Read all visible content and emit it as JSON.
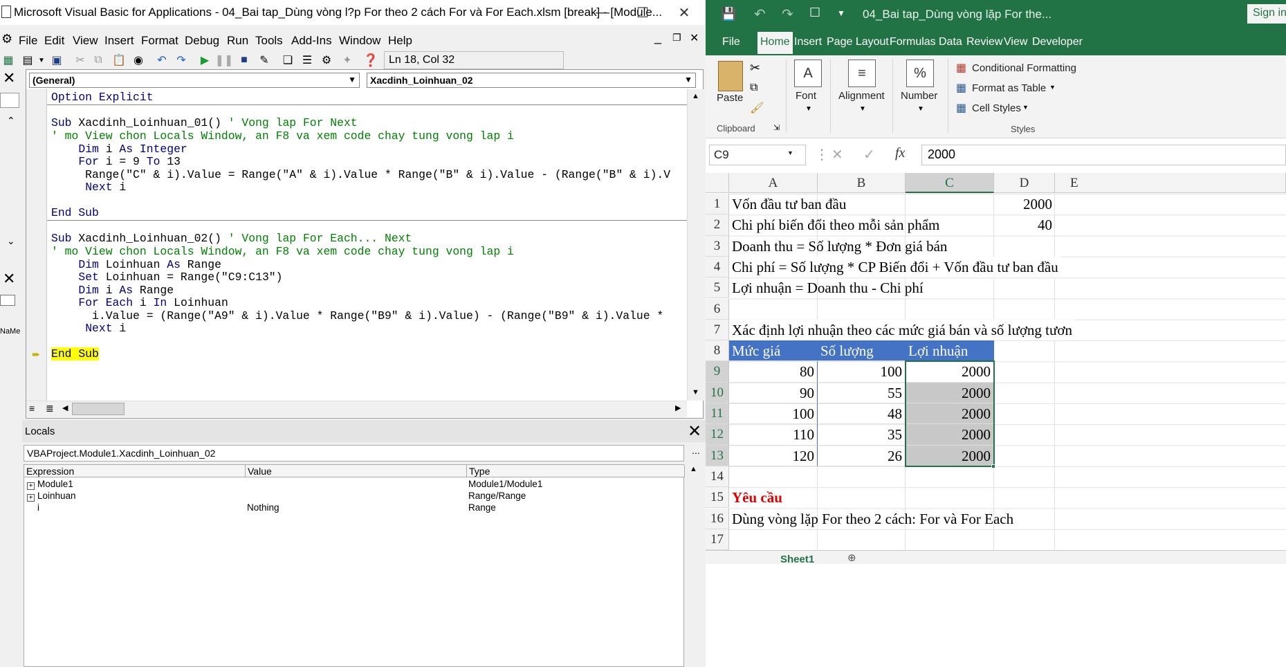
{
  "vba": {
    "title": "Microsoft Visual Basic for Applications - 04_Bai tap_Dùng vòng l?p For theo 2 cách For và For Each.xlsm [break] - [Module...",
    "menu": [
      "File",
      "Edit",
      "View",
      "Insert",
      "Format",
      "Debug",
      "Run",
      "Tools",
      "Add-Ins",
      "Window",
      "Help"
    ],
    "status": "Ln 18, Col 32",
    "combo_object": "(General)",
    "combo_proc": "Xacdinh_Loinhuan_02",
    "side_label": "NaMe",
    "code": {
      "l1": "Option Explicit",
      "l2": "Sub Xacdinh_Loinhuan_01() ' Vong lap For Next",
      "l3": "' mo View chon Locals Window, an F8 va xem code chay tung vong lap i",
      "l4": "    Dim i As Integer",
      "l5": "    For i = 9 To 13",
      "l6": "     Range(\"C\" & i).Value = Range(\"A\" & i).Value * Range(\"B\" & i).Value - (Range(\"B\" & i).V",
      "l7": "     Next i",
      "l8": "End Sub",
      "l9": "Sub Xacdinh_Loinhuan_02() ' Vong lap For Each... Next",
      "l10": "' mo View chon Locals Window, an F8 va xem code chay tung vong lap i",
      "l11": "    Dim Loinhuan As Range",
      "l12": "    Set Loinhuan = Range(\"C9:C13\")",
      "l13": "    Dim i As Range",
      "l14": "    For Each i In Loinhuan",
      "l15": "      i.Value = (Range(\"A9\" & i).Value * Range(\"B9\" & i).Value) - (Range(\"B9\" & i).Value *",
      "l16": "     Next i",
      "l17": "End Sub"
    },
    "locals": {
      "title": "Locals",
      "context": "VBAProject.Module1.Xacdinh_Loinhuan_02",
      "context_btn": "...",
      "headers": [
        "Expression",
        "Value",
        "Type"
      ],
      "rows": [
        {
          "expr": "Module1",
          "value": "",
          "type": "Module1/Module1",
          "expand": "+"
        },
        {
          "expr": "Loinhuan",
          "value": "",
          "type": "Range/Range",
          "expand": "+"
        },
        {
          "expr": "i",
          "value": "Nothing",
          "type": "Range",
          "expand": ""
        }
      ]
    }
  },
  "excel": {
    "title": "04_Bai tap_Dùng vòng lặp For the...",
    "signin": "Sign in",
    "tabs": [
      "File",
      "Home",
      "Insert",
      "Page Layout",
      "Formulas",
      "Data",
      "Review",
      "View",
      "Developer"
    ],
    "ribbon": {
      "paste": "Paste",
      "clipboard": "Clipboard",
      "font": "Font",
      "alignment": "Alignment",
      "number": "Number",
      "number_icon_text": "%",
      "font_icon_text": "A",
      "conditional": "Conditional Formatting",
      "format_table": "Format as Table",
      "cell_styles": "Cell Styles",
      "styles": "Styles"
    },
    "namebox": "C9",
    "fx": "fx",
    "formula_value": "2000",
    "columns": [
      "A",
      "B",
      "C",
      "D",
      "E"
    ],
    "rows": {
      "r1": {
        "a": "Vốn đầu tư ban đầu",
        "d": "2000"
      },
      "r2": {
        "a": "Chi phí biến đổi theo mỗi sản phẩm",
        "d": "40"
      },
      "r3": {
        "a": "Doanh thu = Số lượng * Đơn giá bán"
      },
      "r4": {
        "a": "Chi phí = Số lượng * CP Biến đổi + Vốn đầu tư ban đầu"
      },
      "r5": {
        "a": "Lợi nhuận = Doanh thu - Chi phí"
      },
      "r7": {
        "a": "Xác định lợi nhuận theo các mức giá bán và số lượng tươn"
      },
      "r8": {
        "a": "Mức giá",
        "b": "Số lượng",
        "c": "Lợi nhuận"
      },
      "table": [
        {
          "a": "80",
          "b": "100",
          "c": "2000"
        },
        {
          "a": "90",
          "b": "55",
          "c": "2000"
        },
        {
          "a": "100",
          "b": "48",
          "c": "2000"
        },
        {
          "a": "110",
          "b": "35",
          "c": "2000"
        },
        {
          "a": "120",
          "b": "26",
          "c": "2000"
        }
      ],
      "r15": {
        "a": "Yêu cầu"
      },
      "r16": {
        "a": "Dùng vòng lặp For theo 2 cách: For và For Each"
      }
    },
    "row_numbers": [
      "1",
      "2",
      "3",
      "4",
      "5",
      "6",
      "7",
      "8",
      "9",
      "10",
      "11",
      "12",
      "13",
      "14",
      "15",
      "16",
      "17"
    ],
    "sheet_tab": "Sheet1",
    "colors": {
      "excel_green": "#217346",
      "table_header": "#4472c4",
      "highlight": "#ffff00",
      "red": "#e00000"
    }
  }
}
